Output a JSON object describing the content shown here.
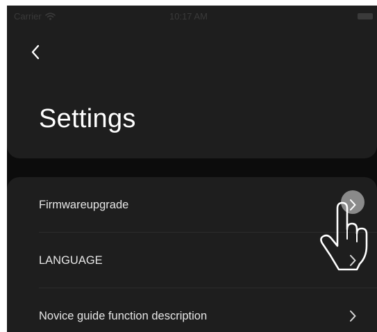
{
  "status_bar": {
    "carrier": "Carrier",
    "time": "10:17 AM",
    "wifi_icon": "wifi-icon",
    "battery_icon": "battery-icon"
  },
  "header": {
    "back_icon": "chevron-left-icon",
    "title": "Settings"
  },
  "settings": {
    "items": [
      {
        "label": "Firmwareupgrade",
        "icon": "chevron-right-icon"
      },
      {
        "label": "LANGUAGE",
        "icon": "chevron-right-icon"
      },
      {
        "label": "Novice guide function description",
        "icon": "chevron-right-icon"
      }
    ]
  },
  "overlay": {
    "pointer_icon": "hand-pointer-icon"
  },
  "colors": {
    "background": "#0c0c0c",
    "card": "#1e1e1e",
    "text": "#e6e6e6",
    "title": "#ffffff",
    "press_highlight": "#8a8a8a"
  }
}
